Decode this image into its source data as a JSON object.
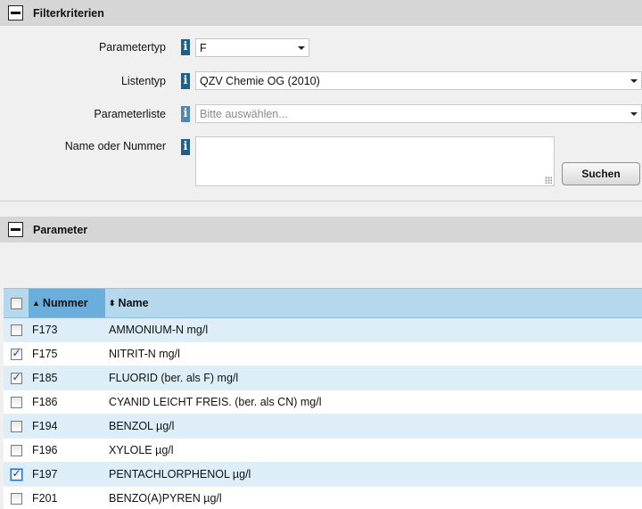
{
  "filter_section": {
    "title": "Filterkriterien",
    "fields": {
      "parametertyp": {
        "label": "Parametertyp",
        "value": "F"
      },
      "listentyp": {
        "label": "Listentyp",
        "value": "QZV Chemie OG (2010)"
      },
      "parameterliste": {
        "label": "Parameterliste",
        "placeholder": "Bitte auswählen..."
      },
      "name_oder_nummer": {
        "label": "Name oder Nummer",
        "value": ""
      }
    },
    "search_button": "Suchen"
  },
  "parameter_section": {
    "title": "Parameter",
    "columns": {
      "nummer": "Nummer",
      "name": "Name"
    },
    "sort": {
      "column": "nummer",
      "direction": "ascending"
    },
    "rows": [
      {
        "nummer": "F173",
        "name": "AMMONIUM-N mg/l",
        "checked": false
      },
      {
        "nummer": "F175",
        "name": "NITRIT-N mg/l",
        "checked": true
      },
      {
        "nummer": "F185",
        "name": "FLUORID (ber. als F) mg/l",
        "checked": true
      },
      {
        "nummer": "F186",
        "name": "CYANID LEICHT FREIS. (ber. als CN) mg/l",
        "checked": false
      },
      {
        "nummer": "F194",
        "name": "BENZOL µg/l",
        "checked": false
      },
      {
        "nummer": "F196",
        "name": "XYLOLE µg/l",
        "checked": false
      },
      {
        "nummer": "F197",
        "name": "PENTACHLORPHENOL µg/l",
        "checked": true
      },
      {
        "nummer": "F201",
        "name": "BENZO(A)PYREN µg/l",
        "checked": false
      }
    ]
  },
  "icons": {
    "info": "info-icon",
    "collapse": "collapse-minus-icon",
    "dropdown": "chevron-down-icon"
  },
  "colors": {
    "header_bg": "#d6d6d6",
    "info_blue": "#1f5f8c",
    "table_header": "#b5d8ed",
    "sorted_column": "#6aaedb",
    "row_alt": "#ddeef8"
  }
}
